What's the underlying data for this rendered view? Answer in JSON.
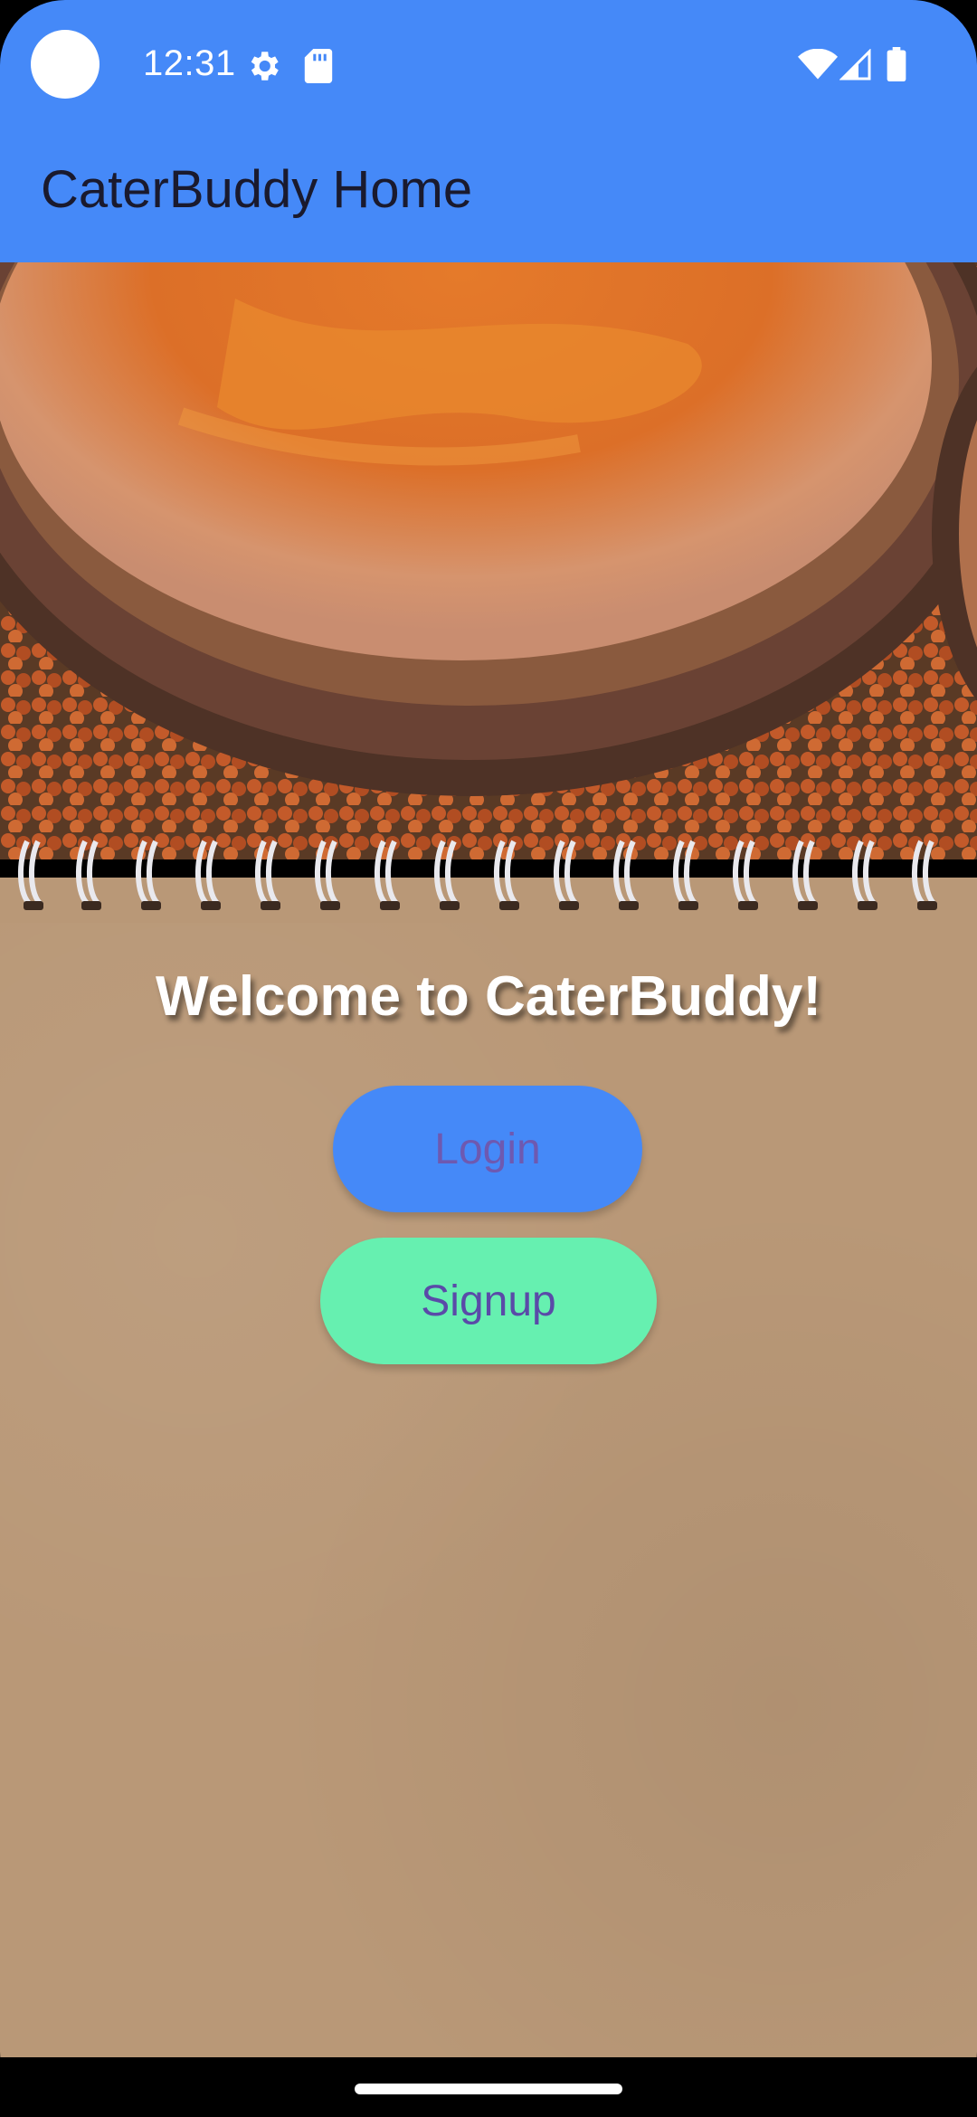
{
  "status_bar": {
    "time": "12:31",
    "icons": [
      "settings-icon",
      "sd-card-icon",
      "wifi-icon",
      "signal-icon",
      "battery-icon"
    ]
  },
  "app_bar": {
    "title": "CaterBuddy Home",
    "background_color": "#4589F8"
  },
  "hero": {
    "description_icon": "soup-bowl-image"
  },
  "main": {
    "welcome": "Welcome to CaterBuddy!",
    "login_label": "Login",
    "signup_label": "Signup",
    "login_color": "#4589F8",
    "signup_color": "#66F0B0"
  }
}
